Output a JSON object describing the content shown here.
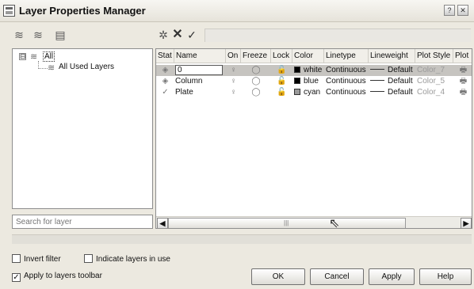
{
  "window": {
    "title": "Layer Properties Manager",
    "help_label": "?",
    "close_label": "✕"
  },
  "toolbar_left": [
    {
      "name": "new-property-filter-button",
      "glyph": "≋"
    },
    {
      "name": "new-group-filter-button",
      "glyph": "≋"
    },
    {
      "name": "layer-states-manager-button",
      "glyph": "▤"
    }
  ],
  "toolbar_right": [
    {
      "name": "new-layer-button",
      "glyph": "✲"
    },
    {
      "name": "delete-layer-button",
      "glyph": "✕"
    },
    {
      "name": "set-current-button",
      "glyph": "✓"
    }
  ],
  "tree": {
    "expander": "⊟",
    "root_label": "All",
    "child_label": "All Used Layers"
  },
  "search": {
    "placeholder": "Search for layer"
  },
  "columns": [
    "Stat",
    "Name",
    "On",
    "Freeze",
    "Lock",
    "Color",
    "Linetype",
    "Lineweight",
    "Plot Style",
    "Plot"
  ],
  "layers": [
    {
      "name": "0",
      "color_name": "white",
      "color_hex": "#000000",
      "linetype": "Continuous",
      "lineweight": "Default",
      "plot_style": "Color_7",
      "selected": true,
      "current": false
    },
    {
      "name": "Column",
      "color_name": "blue",
      "color_hex": "#000000",
      "linetype": "Continuous",
      "lineweight": "Default",
      "plot_style": "Color_5",
      "selected": false,
      "current": false
    },
    {
      "name": "Plate",
      "color_name": "cyan",
      "color_hex": "#9a9a9a",
      "linetype": "Continuous",
      "lineweight": "Default",
      "plot_style": "Color_4",
      "selected": false,
      "current": true
    }
  ],
  "icons": {
    "status_layer": "◈",
    "status_current": "✓",
    "on": "♀",
    "freeze": "◯",
    "lock": "🔓",
    "plot": "🖶"
  },
  "scrollbar": {
    "left": "◀",
    "right": "▶",
    "grip": "|||"
  },
  "options": {
    "invert_filter": {
      "label": "Invert filter",
      "checked": false
    },
    "indicate_in_use": {
      "label": "Indicate layers in use",
      "checked": false
    },
    "apply_to_toolbar": {
      "label": "Apply to layers toolbar",
      "checked": true
    }
  },
  "buttons": {
    "ok": "OK",
    "cancel": "Cancel",
    "apply": "Apply",
    "help": "Help"
  }
}
